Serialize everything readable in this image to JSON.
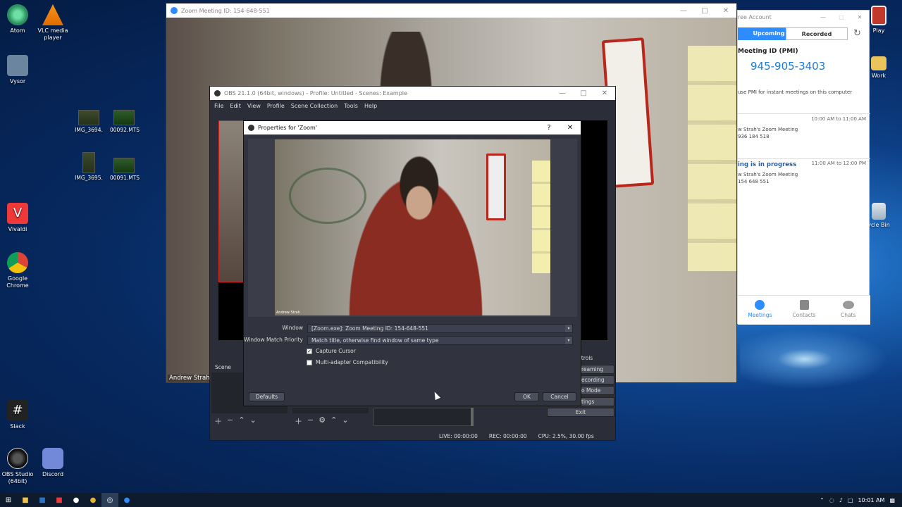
{
  "desktop": {
    "icons_left": [
      {
        "label": "Atom",
        "icon": "atom-icon",
        "color": "#3fb27f"
      },
      {
        "label": "Vysor",
        "icon": "vysor-icon",
        "color": "#546c84"
      },
      {
        "label": "Vivaldi",
        "icon": "vivaldi-icon",
        "color": "#ef3939"
      },
      {
        "label": "Google Chrome",
        "icon": "chrome-icon",
        "color": "#e2b52a"
      },
      {
        "label": "Slack",
        "icon": "slack-icon",
        "color": "#333333"
      },
      {
        "label": "OBS Studio (64bit)",
        "icon": "obs-icon",
        "color": "#222222"
      }
    ],
    "vlc": {
      "label": "VLC media player",
      "icon": "vlc-icon"
    },
    "discord": {
      "label": "Discord",
      "icon": "discord-icon"
    },
    "thumbs": [
      "IMG_3694.",
      "00092.MTS",
      "IMG_3695.",
      "00091.MTS"
    ],
    "right_icons": [
      {
        "label": "Play",
        "icon": "play-icon"
      },
      {
        "label": "Work",
        "icon": "folder-icon"
      },
      {
        "label": "ycle Bin",
        "icon": "recycle-bin-icon"
      }
    ]
  },
  "zoom_meeting": {
    "title": "Zoom Meeting ID: 154-648-551",
    "participant_name": "Andrew Strah"
  },
  "zoom_home": {
    "title": "ree Account",
    "tabs": {
      "upcoming": "Upcoming",
      "recorded": "Recorded"
    },
    "pmi_label": "Meeting ID (PMI)",
    "pmi_value": "945-905-3403",
    "pmi_note": "use PMI for instant meetings on this computer",
    "meetings": [
      {
        "time": "10:00 AM to 11:00 AM",
        "status": "",
        "title": "w Strah's Zoom Meeting",
        "id": "936 184 518"
      },
      {
        "time": "11:00 AM to 12:00 PM",
        "status": "ing is in progress",
        "title": "w Strah's Zoom Meeting",
        "id": "154 648 551"
      }
    ],
    "nav": [
      {
        "label": "Meetings",
        "icon": "clock-icon"
      },
      {
        "label": "Contacts",
        "icon": "contacts-icon"
      },
      {
        "label": "Chats",
        "icon": "chat-icon"
      }
    ]
  },
  "obs": {
    "title": "OBS 21.1.0 (64bit, windows) - Profile: Untitled - Scenes: Example",
    "menu": [
      "File",
      "Edit",
      "View",
      "Profile",
      "Scene Collection",
      "Tools",
      "Help"
    ],
    "scene_label": "Scene",
    "controls_label": "ntrols",
    "controls": [
      "reaming",
      "ecording",
      "o Mode",
      "tings",
      "Exit"
    ],
    "status": {
      "live": "LIVE: 00:00:00",
      "rec": "REC: 00:00:00",
      "cpu": "CPU: 2.5%, 30.00 fps"
    }
  },
  "properties": {
    "title": "Properties for 'Zoom'",
    "help": "?",
    "window_label": "Window",
    "window_value": "[Zoom.exe]: Zoom Meeting ID: 154-648-551",
    "match_label": "Window Match Priority",
    "match_value": "Match title, otherwise find window of same type",
    "capture_cursor_label": "Capture Cursor",
    "capture_cursor": true,
    "multi_adapter_label": "Multi-adapter Compatibility",
    "multi_adapter": false,
    "preview_caption": "Andrew Strah",
    "defaults_button": "Defaults",
    "ok_button": "OK",
    "cancel_button": "Cancel"
  },
  "taskbar": {
    "time": "10:01 AM"
  }
}
